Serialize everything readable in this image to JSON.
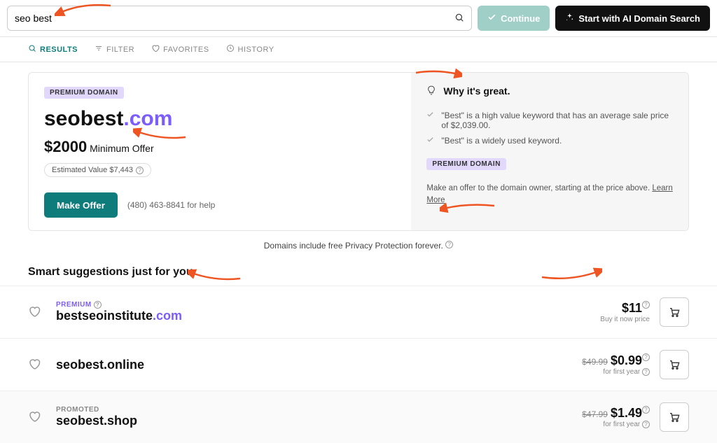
{
  "search": {
    "value": "seo best"
  },
  "buttons": {
    "continue": "Continue",
    "ai": "Start with AI Domain Search"
  },
  "tabs": {
    "results": "RESULTS",
    "filter": "FILTER",
    "favorites": "FAVORITES",
    "history": "HISTORY"
  },
  "hero": {
    "badge": "PREMIUM DOMAIN",
    "domain_base": "seobest",
    "domain_tld": ".com",
    "offer_price": "$2000",
    "offer_label": "Minimum Offer",
    "est_label": "Estimated Value $7,443",
    "make_offer": "Make Offer",
    "help": "(480) 463-8841 for help"
  },
  "great": {
    "title": "Why it's great.",
    "points": [
      "\"Best\" is a high value keyword that has an average sale price of $2,039.00.",
      "\"Best\" is a widely used keyword."
    ],
    "badge": "PREMIUM DOMAIN",
    "desc": "Make an offer to the domain owner, starting at the price above.",
    "learn": "Learn More"
  },
  "privacy": "Domains include free Privacy Protection forever.",
  "suggestions_title": "Smart suggestions just for you",
  "results": [
    {
      "tag": "PREMIUM",
      "tag_type": "premium",
      "base": "bestseoinstitute",
      "tld": ".com",
      "old": "",
      "price": "$11",
      "sub": "Buy it now price"
    },
    {
      "tag": "",
      "tag_type": "",
      "base": "seobest",
      "tld": ".online",
      "old": "$49.99",
      "price": "$0.99",
      "sub": "for first year"
    },
    {
      "tag": "PROMOTED",
      "tag_type": "promo",
      "base": "seobest",
      "tld": ".shop",
      "old": "$47.99",
      "price": "$1.49",
      "sub": "for first year"
    }
  ]
}
